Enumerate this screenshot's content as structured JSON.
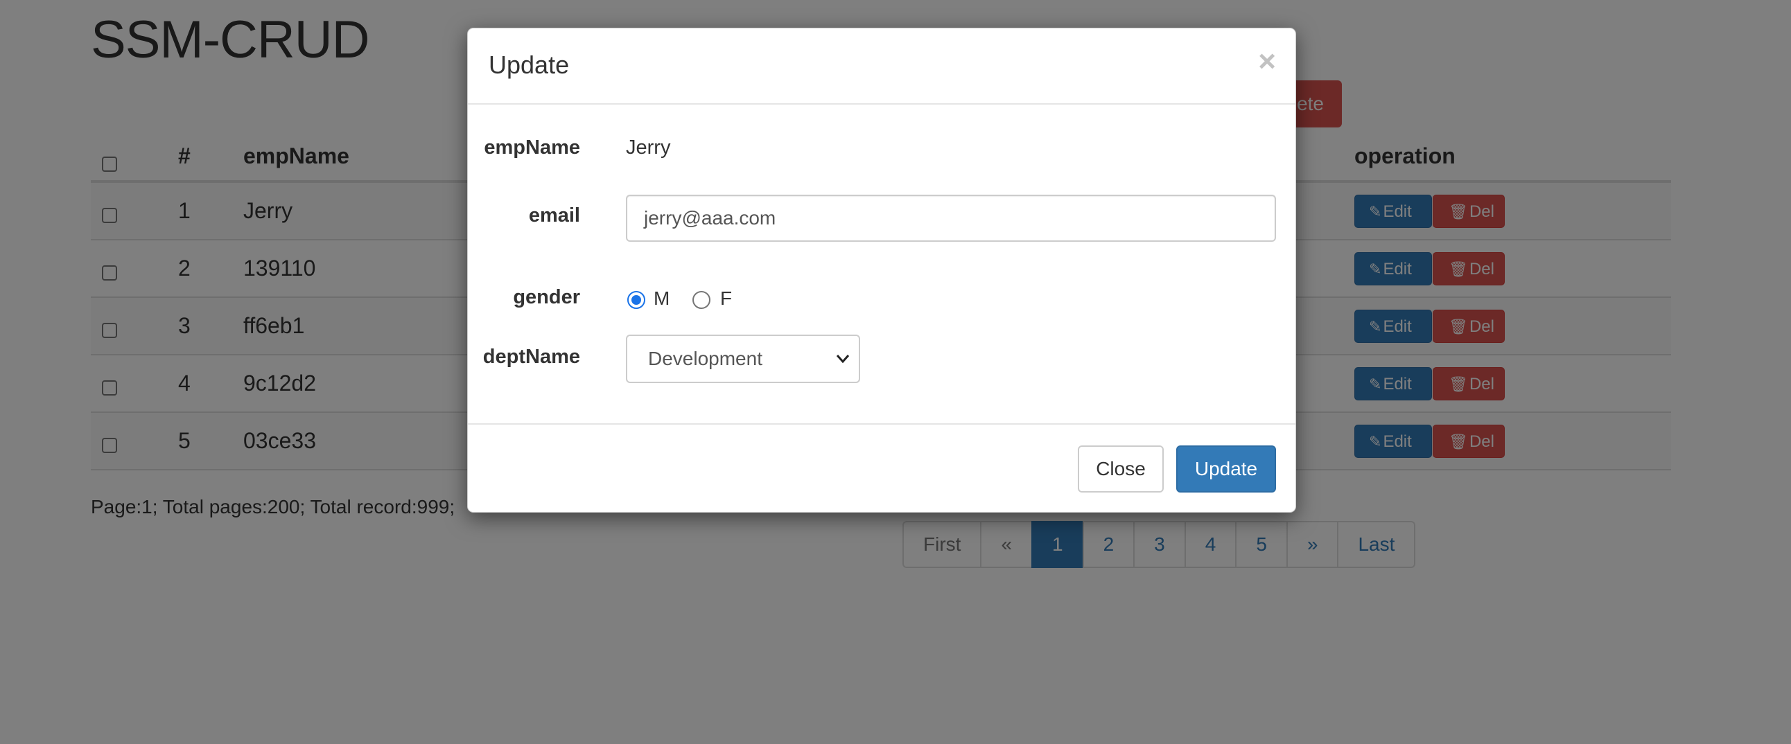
{
  "app_title": "SSM-CRUD",
  "toolbar": {
    "delete_label": "ete",
    "colors": {
      "danger": "#d9534f",
      "primary": "#337ab7"
    }
  },
  "table": {
    "headers": {
      "id": "#",
      "emp_name": "empName",
      "operation": "operation"
    },
    "rows": [
      {
        "id": "1",
        "emp_name": "Jerry"
      },
      {
        "id": "2",
        "emp_name": "139110"
      },
      {
        "id": "3",
        "emp_name": "ff6eb1"
      },
      {
        "id": "4",
        "emp_name": "9c12d2"
      },
      {
        "id": "5",
        "emp_name": "03ce33"
      }
    ],
    "edit_label": "Edit",
    "del_label": "Del",
    "edit_icon": "pencil-icon",
    "del_icon": "trash-icon"
  },
  "page_info": "Page:1; Total pages:200; Total record:999;",
  "pagination": [
    "First",
    "«",
    "1",
    "2",
    "3",
    "4",
    "5",
    "»",
    "Last"
  ],
  "pagination_active": "1",
  "modal": {
    "title": "Update",
    "close_glyph": "×",
    "fields": {
      "emp_name_label": "empName",
      "emp_name_value": "Jerry",
      "email_label": "email",
      "email_value": "jerry@aaa.com",
      "gender_label": "gender",
      "gender_options": [
        "M",
        "F"
      ],
      "gender_selected": "M",
      "dept_label": "deptName",
      "dept_value": "Development"
    },
    "close_button": "Close",
    "update_button": "Update"
  }
}
